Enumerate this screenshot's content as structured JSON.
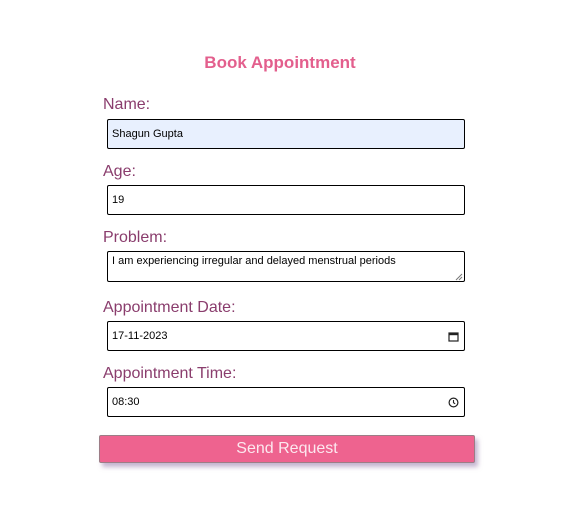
{
  "form": {
    "title": "Book Appointment",
    "name_label": "Name:",
    "name_value": "Shagun Gupta",
    "age_label": "Age:",
    "age_value": "19",
    "problem_label": "Problem:",
    "problem_value": "I am experiencing irregular and delayed menstrual periods",
    "date_label": "Appointment Date:",
    "date_value": "17-11-2023",
    "time_label": "Appointment Time:",
    "time_value": "08:30",
    "submit_label": "Send Request"
  },
  "icons": {
    "date_picker": "calendar-icon",
    "time_picker": "clock-icon",
    "textarea_grip": "resize-grip-icon"
  },
  "colors": {
    "title": "#e35f8d",
    "label": "#8a3d6d",
    "button_bg": "#ee638f",
    "button_text": "#fce8ef",
    "autofill_bg": "#e8f0fe"
  }
}
